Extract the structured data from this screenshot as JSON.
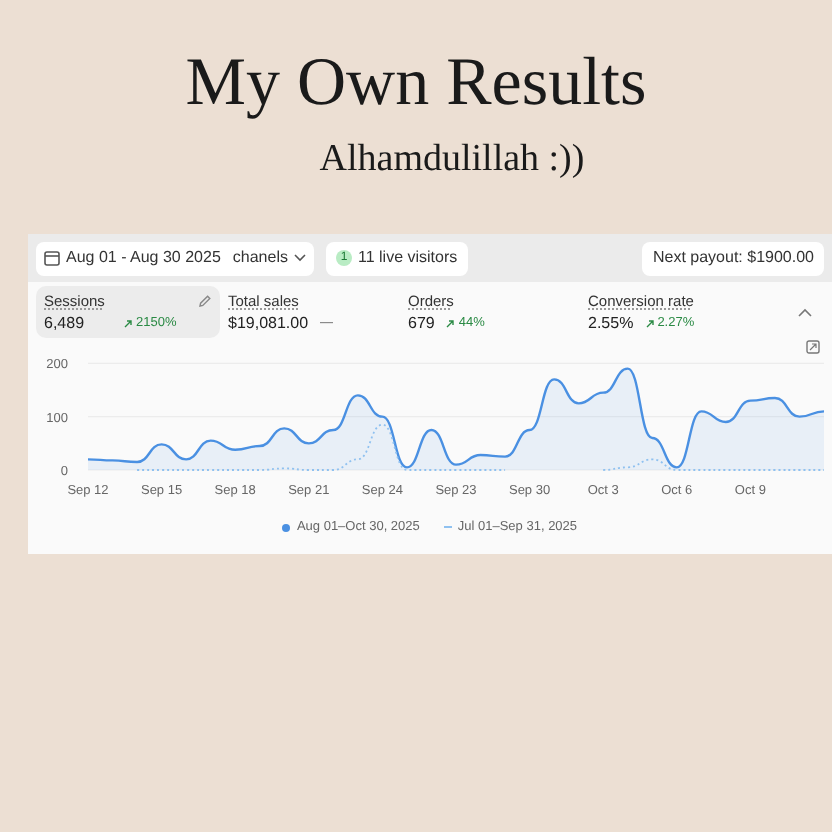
{
  "heading": {
    "title": "My Own Results",
    "subtitle": "Alhamdulillah :))"
  },
  "toolbar": {
    "date_range": "Aug 01 - Aug 30 2025",
    "channel_filter": "chanels",
    "live_count": "1",
    "live_label": "11 live visitors",
    "payout": "Next payout: $1900.00"
  },
  "metrics": [
    {
      "label": "Sessions",
      "value": "6,489",
      "change": "2150%",
      "selected": true
    },
    {
      "label": "Total sales",
      "value": "$19,081.00",
      "change": "—",
      "selected": false
    },
    {
      "label": "Orders",
      "value": "679",
      "change": "44%",
      "selected": false
    },
    {
      "label": "Conversion rate",
      "value": "2.55%",
      "change": "2.27%",
      "selected": false
    }
  ],
  "chart": {
    "chart_data": {
      "type": "area",
      "categories": [
        "Sep 12",
        null,
        null,
        "Sep 15",
        null,
        null,
        "Sep 18",
        null,
        null,
        "Sep 21",
        null,
        null,
        "Sep 24",
        null,
        null,
        "Sep 23",
        null,
        null,
        "Sep 30",
        null,
        null,
        "Oct 3",
        null,
        null,
        "Oct 6",
        null,
        null,
        "Oct 9",
        null,
        null,
        null
      ],
      "yticks": [
        0,
        100,
        200
      ],
      "ylim": [
        0,
        210
      ],
      "series": [
        {
          "name": "Aug 01–Oct 30, 2025",
          "color": "#4a90e2",
          "type": "area",
          "line_style": "solid",
          "values": [
            20,
            18,
            15,
            48,
            20,
            55,
            38,
            45,
            78,
            50,
            75,
            140,
            100,
            5,
            75,
            10,
            28,
            25,
            75,
            170,
            125,
            145,
            190,
            60,
            5,
            110,
            90,
            130,
            135,
            100,
            110
          ]
        },
        {
          "name": "Jul 01–Sep 31, 2025",
          "color": "#8fc1f0",
          "type": "line",
          "line_style": "dotted",
          "values": [
            null,
            null,
            0,
            0,
            0,
            0,
            0,
            0,
            3,
            0,
            0,
            20,
            85,
            0,
            0,
            0,
            0,
            0,
            null,
            null,
            null,
            0,
            5,
            20,
            0,
            0,
            0,
            0,
            0,
            0,
            0
          ]
        }
      ]
    }
  }
}
